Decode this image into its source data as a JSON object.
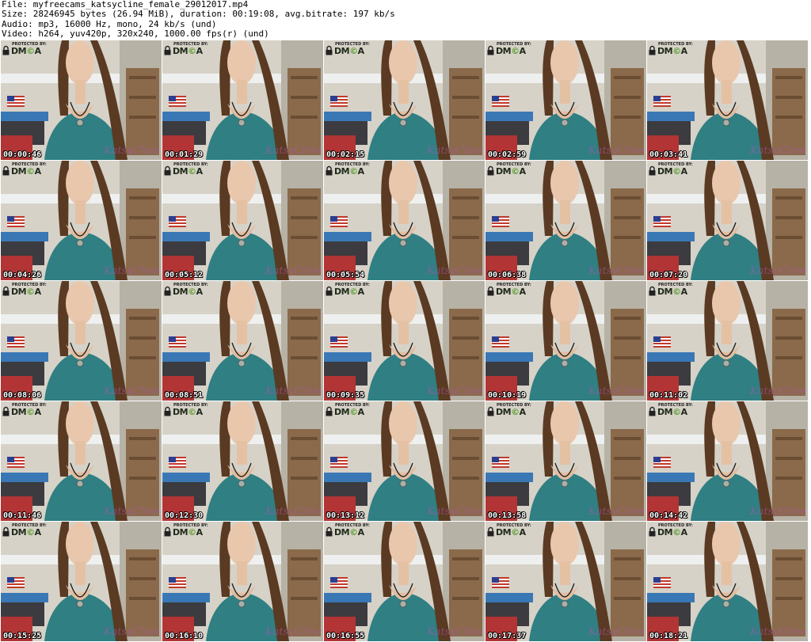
{
  "header": {
    "file": "File: myfreecams_katsycline_female_29012017.mp4",
    "size": "Size: 28246945 bytes (26.94 MiB), duration: 00:19:08, avg.bitrate: 197 kb/s",
    "audio": "Audio: mp3, 16000 Hz, mono, 24 kb/s (und)",
    "video": "Video: h264, yuv420p, 320x240, 1000.00 fps(r) (und)"
  },
  "overlay": {
    "protected_by": "PROTECTED BY:",
    "dmca_dm": "DM",
    "dmca_c": "©",
    "dmca_a": "A",
    "watermark": "KatsyCline"
  },
  "thumbnails": [
    {
      "timestamp": "00:00:46"
    },
    {
      "timestamp": "00:01:29"
    },
    {
      "timestamp": "00:02:15"
    },
    {
      "timestamp": "00:02:59"
    },
    {
      "timestamp": "00:03:41"
    },
    {
      "timestamp": "00:04:26"
    },
    {
      "timestamp": "00:05:12"
    },
    {
      "timestamp": "00:05:54"
    },
    {
      "timestamp": "00:06:38"
    },
    {
      "timestamp": "00:07:20"
    },
    {
      "timestamp": "00:08:06"
    },
    {
      "timestamp": "00:08:51"
    },
    {
      "timestamp": "00:09:35"
    },
    {
      "timestamp": "00:10:19"
    },
    {
      "timestamp": "00:11:02"
    },
    {
      "timestamp": "00:11:46"
    },
    {
      "timestamp": "00:12:30"
    },
    {
      "timestamp": "00:13:12"
    },
    {
      "timestamp": "00:13:58"
    },
    {
      "timestamp": "00:14:42"
    },
    {
      "timestamp": "00:15:25"
    },
    {
      "timestamp": "00:16:10"
    },
    {
      "timestamp": "00:16:55"
    },
    {
      "timestamp": "00:17:37"
    },
    {
      "timestamp": "00:18:21"
    }
  ],
  "colors": {
    "shirt": "#2f7f83",
    "hair": "#5a3a22",
    "wall": "#d9d5cc",
    "timestamp_text": "#ffffff",
    "watermark": "#b254b0"
  }
}
